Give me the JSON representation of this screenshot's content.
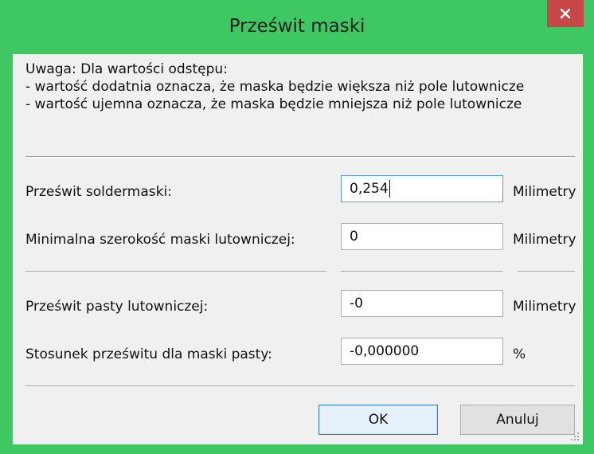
{
  "window": {
    "title": "Prześwit maski",
    "close_icon": "close-icon",
    "accent": "#3ec763",
    "close_color": "#c74646"
  },
  "note": {
    "line1": "Uwaga: Dla wartości odstępu:",
    "line2": "- wartość dodatnia oznacza, że maska będzie większa niż pole lutownicze",
    "line3": "- wartość ujemna oznacza, że maska będzie mniejsza niż pole lutownicze"
  },
  "fields": [
    {
      "label": "Prześwit soldermaski:",
      "value": "0,254",
      "unit": "Milimetry"
    },
    {
      "label": "Minimalna szerokość maski lutowniczej:",
      "value": "0",
      "unit": "Milimetry"
    },
    {
      "label": "Prześwit pasty lutowniczej:",
      "value": "-0",
      "unit": "Milimetry"
    },
    {
      "label": "Stosunek prześwitu dla maski pasty:",
      "value": "-0,000000",
      "unit": "%"
    }
  ],
  "buttons": {
    "ok": "OK",
    "cancel": "Anuluj"
  }
}
